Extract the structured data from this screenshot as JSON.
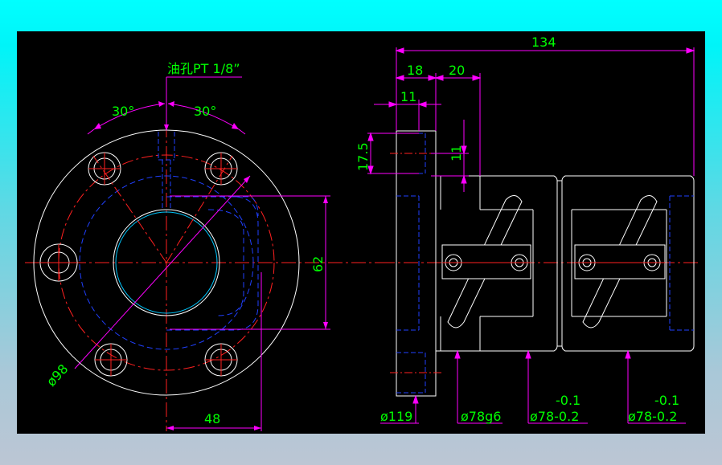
{
  "colors": {
    "outline": "#ffffff",
    "center": "#ff2020",
    "hidden": "#2040ff",
    "dimension": "#ff00ff",
    "text": "#00ff00",
    "bore": "#00c8ff",
    "background": "#000000"
  },
  "front_view": {
    "oil_hole_note": "油孔PT 1/8”",
    "angle_left": "30°",
    "angle_right": "30°",
    "dim_62": "62",
    "dim_48": "48",
    "dim_diameter_98": "ø98"
  },
  "side_view": {
    "dim_134": "134",
    "dim_18": "18",
    "dim_20": "20",
    "dim_11_top": "11",
    "dim_11_vertical": "11",
    "dim_17_5": "17.5",
    "dia_119": "ø119",
    "dia_78g6": "ø78g6",
    "tol_1_upper": "-0.1",
    "tol_1_lower": "ø78-0.2",
    "tol_2_upper": "-0.1",
    "tol_2_lower": "ø78-0.2"
  }
}
